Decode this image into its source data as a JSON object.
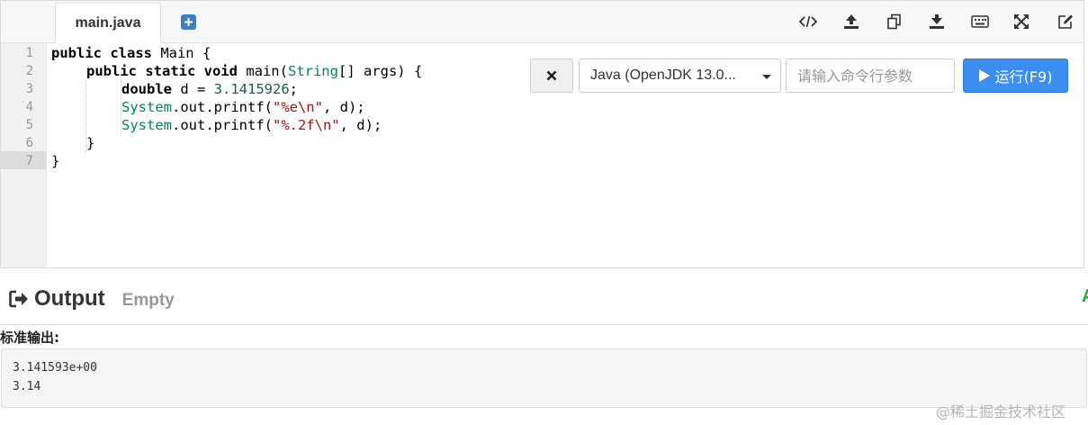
{
  "editor": {
    "tab_label": "main.java",
    "line_numbers": [
      "1",
      "2",
      "3",
      "4",
      "5",
      "6",
      "7"
    ],
    "code": {
      "l1_kw": "public class",
      "l1_rest": " Main {",
      "l2_kw": "public static void",
      "l2_mid": " main(",
      "l2_type": "String",
      "l2_rest": "[] args) {",
      "l3_kw": "double",
      "l3_mid": " d = ",
      "l3_num": "3.1415926",
      "l3_end": ";",
      "l4_type": "System",
      "l4_mid": ".out.printf(",
      "l4_str": "\"%e\\n\"",
      "l4_end": ", d);",
      "l5_type": "System",
      "l5_mid": ".out.printf(",
      "l5_str": "\"%.2f\\n\"",
      "l5_end": ", d);",
      "l6": "}",
      "l7": "}"
    }
  },
  "toolbar": {
    "icons": [
      "code-icon",
      "upload-icon",
      "copy-icon",
      "download-icon",
      "keyboard-icon",
      "fullscreen-icon",
      "edit-icon"
    ]
  },
  "run": {
    "language": "Java (OpenJDK 13.0...",
    "args_placeholder": "请输入命令行参数",
    "run_label": "运行(F9)"
  },
  "output": {
    "title": "Output",
    "status": "Empty",
    "edge_mark": "A",
    "stdout_label": "标准输出:",
    "stdout_lines": [
      "3.141593e+00",
      "3.14"
    ]
  },
  "watermark": "@稀土掘金技术社区",
  "colors": {
    "run_button": "#3b8ef0",
    "keyword": "#000000",
    "number": "#116644",
    "string": "#aa1111",
    "type": "#008855"
  }
}
